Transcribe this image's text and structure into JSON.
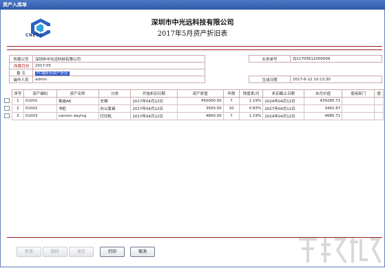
{
  "window": {
    "title": "资产入库单"
  },
  "header": {
    "company": "深圳市中光远科技有限公司",
    "report_title": "2017年5月资产折旧表",
    "logo_text": "CNEOP"
  },
  "info": {
    "company_label": "所属公司",
    "company_value": "深圳市中光远科技有限公司",
    "month_label": "·所属月份",
    "month_value": "2017-05",
    "note_label": "备  注",
    "note_value": "PC端折旧资产折旧",
    "operator_label": "操作人员",
    "operator_value": "admin",
    "bizno_label": "业务单号",
    "bizno_value": "ZJ11705612000009",
    "date_label": "生成日期",
    "date_value": "2017-6-12 10:13:30"
  },
  "table": {
    "headers": [
      "序号",
      "资产编码",
      "资产名称",
      "分类",
      "开始折旧日期",
      "资产原值",
      "年限",
      "残值率/月",
      "折旧截止日期",
      "本月价值",
      "使用部门",
      "使"
    ],
    "rows": [
      {
        "no": "1",
        "code": "01001",
        "name": "奥迪A6",
        "category": "车辆",
        "start": "2017年04月12日",
        "value": "450000.00",
        "years": "7",
        "rate": "1.19%",
        "end": "2024年04月12日",
        "month_value": "439285.71"
      },
      {
        "no": "2",
        "code": "01002",
        "name": "书柜",
        "category": "办公家具",
        "start": "2017年04月12日",
        "value": "3500.00",
        "years": "10",
        "rate": "0.83%",
        "end": "2027年04月12日",
        "month_value": "3441.67"
      },
      {
        "no": "3",
        "code": "01003",
        "name": "cannon daying",
        "category": "打印机",
        "start": "2017年04月12日",
        "value": "4800.00",
        "years": "7",
        "rate": "1.19%",
        "end": "2024年04月12日",
        "month_value": "4685.71"
      }
    ]
  },
  "buttons": {
    "add": "新增",
    "delete": "删除",
    "save": "保存",
    "print": "打印",
    "cancel": "取消"
  }
}
